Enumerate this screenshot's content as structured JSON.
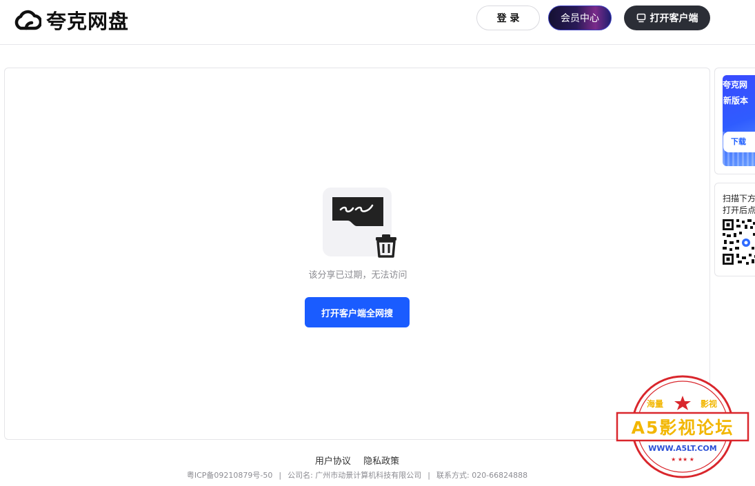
{
  "header": {
    "logo_text": "夸克网盘",
    "login_label": "登 录",
    "vip_label": "会员中心",
    "client_label": "打开客户端"
  },
  "main": {
    "expired_message": "该分享已过期，无法访问",
    "search_button_label": "打开客户端全网搜"
  },
  "sidebar": {
    "banner_title": "夸克网",
    "banner_subtitle": "新版本",
    "banner_button": "下载",
    "qr_line1": "扫描下方",
    "qr_line2": "打开后点"
  },
  "footer": {
    "user_agreement": "用户协议",
    "privacy_policy": "隐私政策",
    "icp": "粤ICP备09210879号-50",
    "company": "公司名: 广州市动景计算机科技有限公司",
    "contact": "联系方式: 020-66824888"
  },
  "watermark": {
    "top_text": "海量",
    "top_text2": "影视",
    "main_text": "A5影视论坛",
    "url": "WWW.A5LT.COM"
  },
  "colors": {
    "primary": "#1a5cff",
    "dark_button": "#2b2e36",
    "stamp_red": "#d9262c",
    "stamp_gold": "#f2b600"
  }
}
